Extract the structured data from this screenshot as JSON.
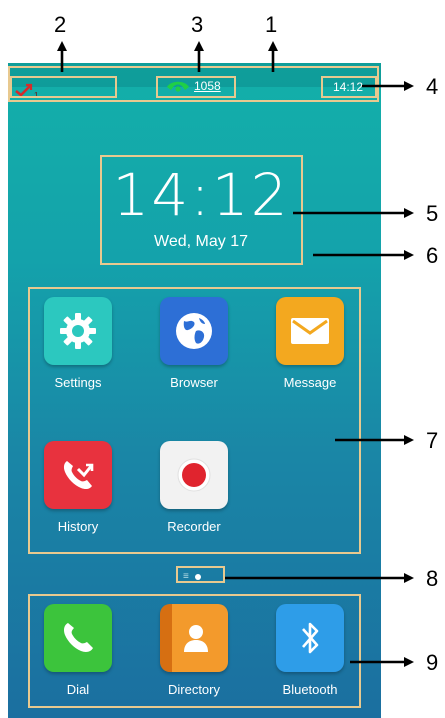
{
  "status_bar": {
    "missed_calls_count": "1",
    "line_extension": "1058",
    "time": "14:12"
  },
  "idle_clock": {
    "time": "14:12",
    "date": "Wed, May 17"
  },
  "apps": [
    {
      "label": "Settings",
      "icon": "gear-icon",
      "color": "#2cc8bf"
    },
    {
      "label": "Browser",
      "icon": "globe-icon",
      "color": "#2d6fd6"
    },
    {
      "label": "Message",
      "icon": "envelope-icon",
      "color": "#f3a81f"
    },
    {
      "label": "History",
      "icon": "missed-call-icon",
      "color": "#e8323e"
    },
    {
      "label": "Recorder",
      "icon": "record-icon",
      "color": "#f2f2f2"
    }
  ],
  "dock": [
    {
      "label": "Dial",
      "icon": "phone-icon",
      "color": "#3cc43c"
    },
    {
      "label": "Directory",
      "icon": "contact-icon",
      "color": "#f08c1f"
    },
    {
      "label": "Bluetooth",
      "icon": "bluetooth-icon",
      "color": "#2e9de8"
    }
  ],
  "callouts": [
    "1",
    "2",
    "3",
    "4",
    "5",
    "6",
    "7",
    "8",
    "9"
  ],
  "colors": {
    "screen_top": "#13b0a9",
    "screen_bottom": "#1b6fa0",
    "callout_border": "#e8c98f",
    "line_registered": "#1fcf46"
  }
}
